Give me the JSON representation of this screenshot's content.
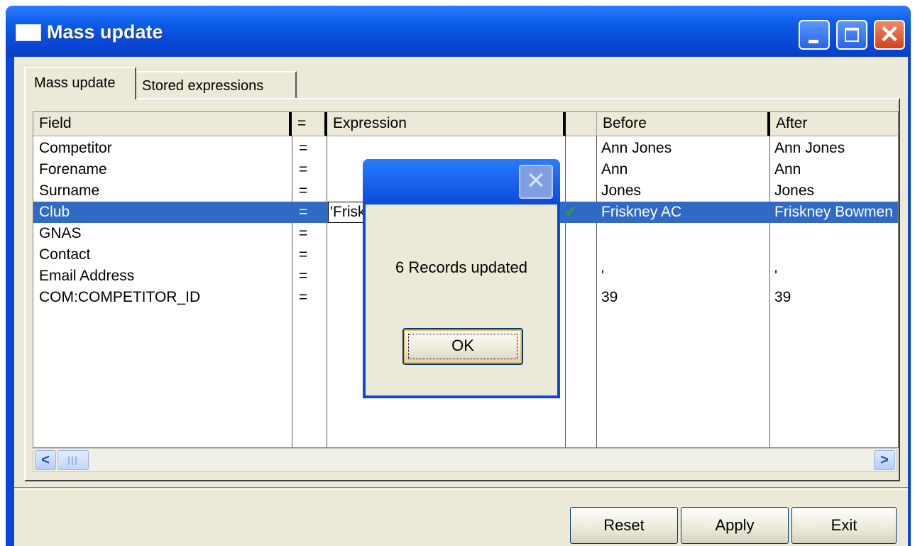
{
  "window": {
    "title": "Mass update"
  },
  "tabs": [
    {
      "label": "Mass update",
      "active": true
    },
    {
      "label": "Stored expressions",
      "active": false
    }
  ],
  "columns": {
    "field": "Field",
    "eq": "=",
    "expression": "Expression",
    "blank": "",
    "before": "Before",
    "after": "After"
  },
  "rows": [
    {
      "field": "Competitor",
      "eq": "=",
      "expression": "",
      "before": "Ann Jones",
      "after": "Ann Jones"
    },
    {
      "field": "Forename",
      "eq": "=",
      "expression": "",
      "before": "Ann",
      "after": "Ann"
    },
    {
      "field": "Surname",
      "eq": "=",
      "expression": "",
      "before": "Jones",
      "after": "Jones"
    },
    {
      "field": "Club",
      "eq": "=",
      "expression": "'Frisk",
      "before": "Friskney AC",
      "after": "Friskney Bowmen"
    },
    {
      "field": "GNAS",
      "eq": "=",
      "expression": "",
      "before": "",
      "after": ""
    },
    {
      "field": "Contact",
      "eq": "=",
      "expression": "",
      "before": "",
      "after": ""
    },
    {
      "field": "Email Address",
      "eq": "=",
      "expression": "",
      "before": "'",
      "after": "'"
    },
    {
      "field": "COM:COMPETITOR_ID",
      "eq": "=",
      "expression": "",
      "before": "39",
      "after": "39"
    }
  ],
  "selected_row": "Club",
  "buttons": {
    "reset": "Reset",
    "apply": "Apply",
    "exit": "Exit"
  },
  "dialog": {
    "message": "6 Records updated",
    "ok": "OK",
    "close_glyph": "✕"
  },
  "icons": {
    "scroll_left": "<",
    "scroll_right": ">",
    "check": "✓"
  },
  "colors": {
    "titlebar": "#0a49d8",
    "selection": "#316ac5",
    "face": "#ece9d8"
  }
}
